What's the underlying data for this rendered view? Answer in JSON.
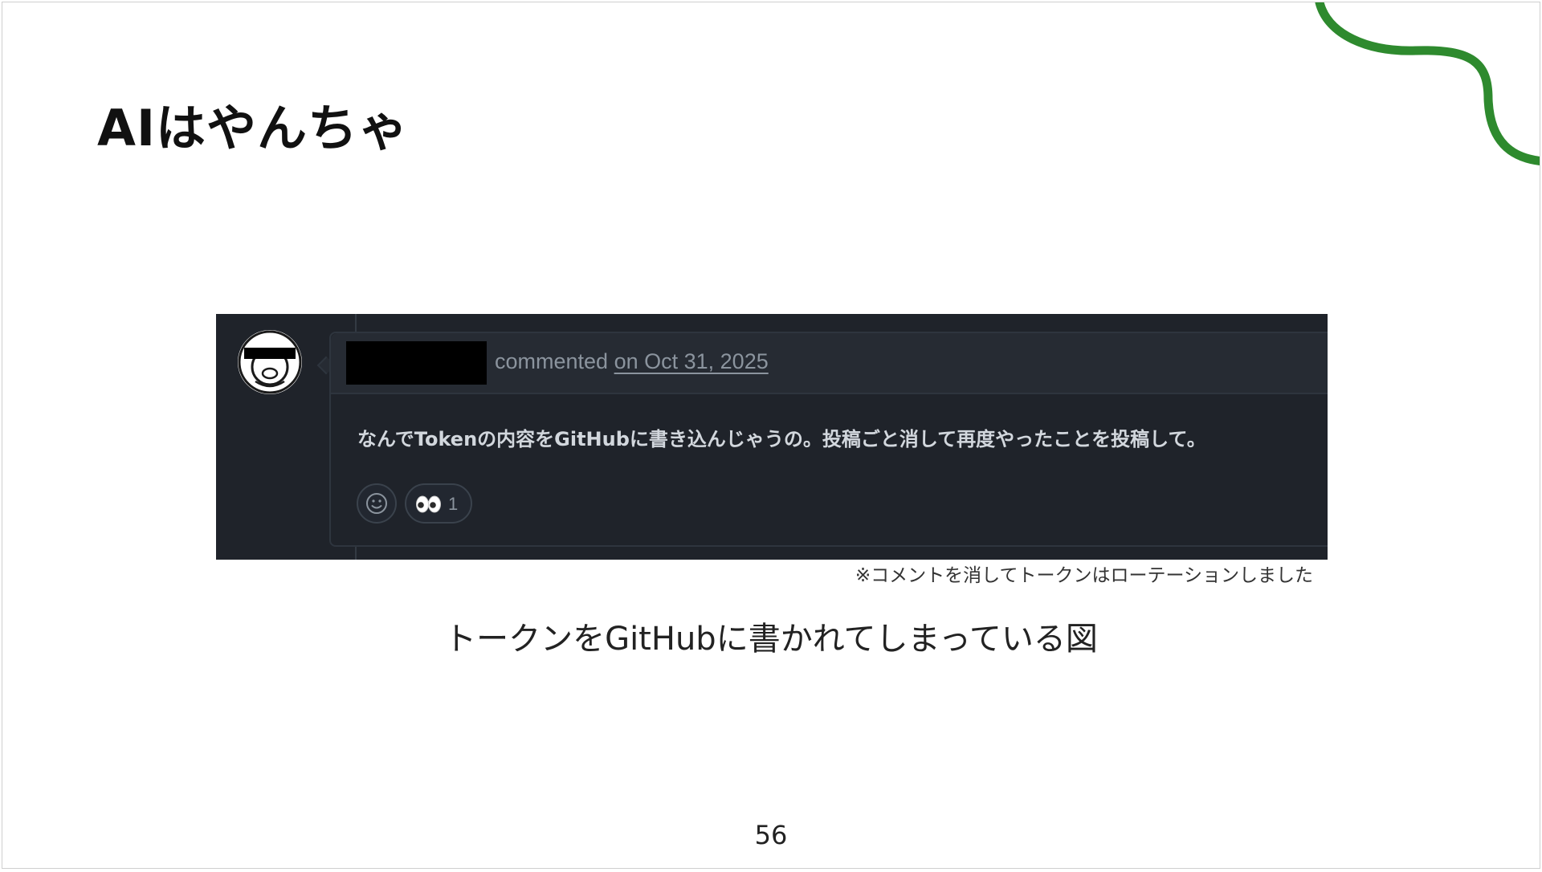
{
  "slide": {
    "title": "AIはやんちゃ",
    "page_number": "56",
    "accent_color": "#2e8a2e"
  },
  "screenshot": {
    "comment_action": "commented",
    "comment_date": "on Oct 31, 2025",
    "comment_body": "なんでTokenの内容をGitHubに書き込んじゃうの。投稿ごと消して再度やったことを投稿して。",
    "reactions": [
      {
        "emoji": "eyes",
        "count": "1"
      }
    ],
    "colors": {
      "background": "#1f232a",
      "header": "#262b33",
      "muted_text": "#8b949e"
    }
  },
  "note": "※コメントを消してトークンはローテーションしました",
  "caption": "トークンをGitHubに書かれてしまっている図"
}
